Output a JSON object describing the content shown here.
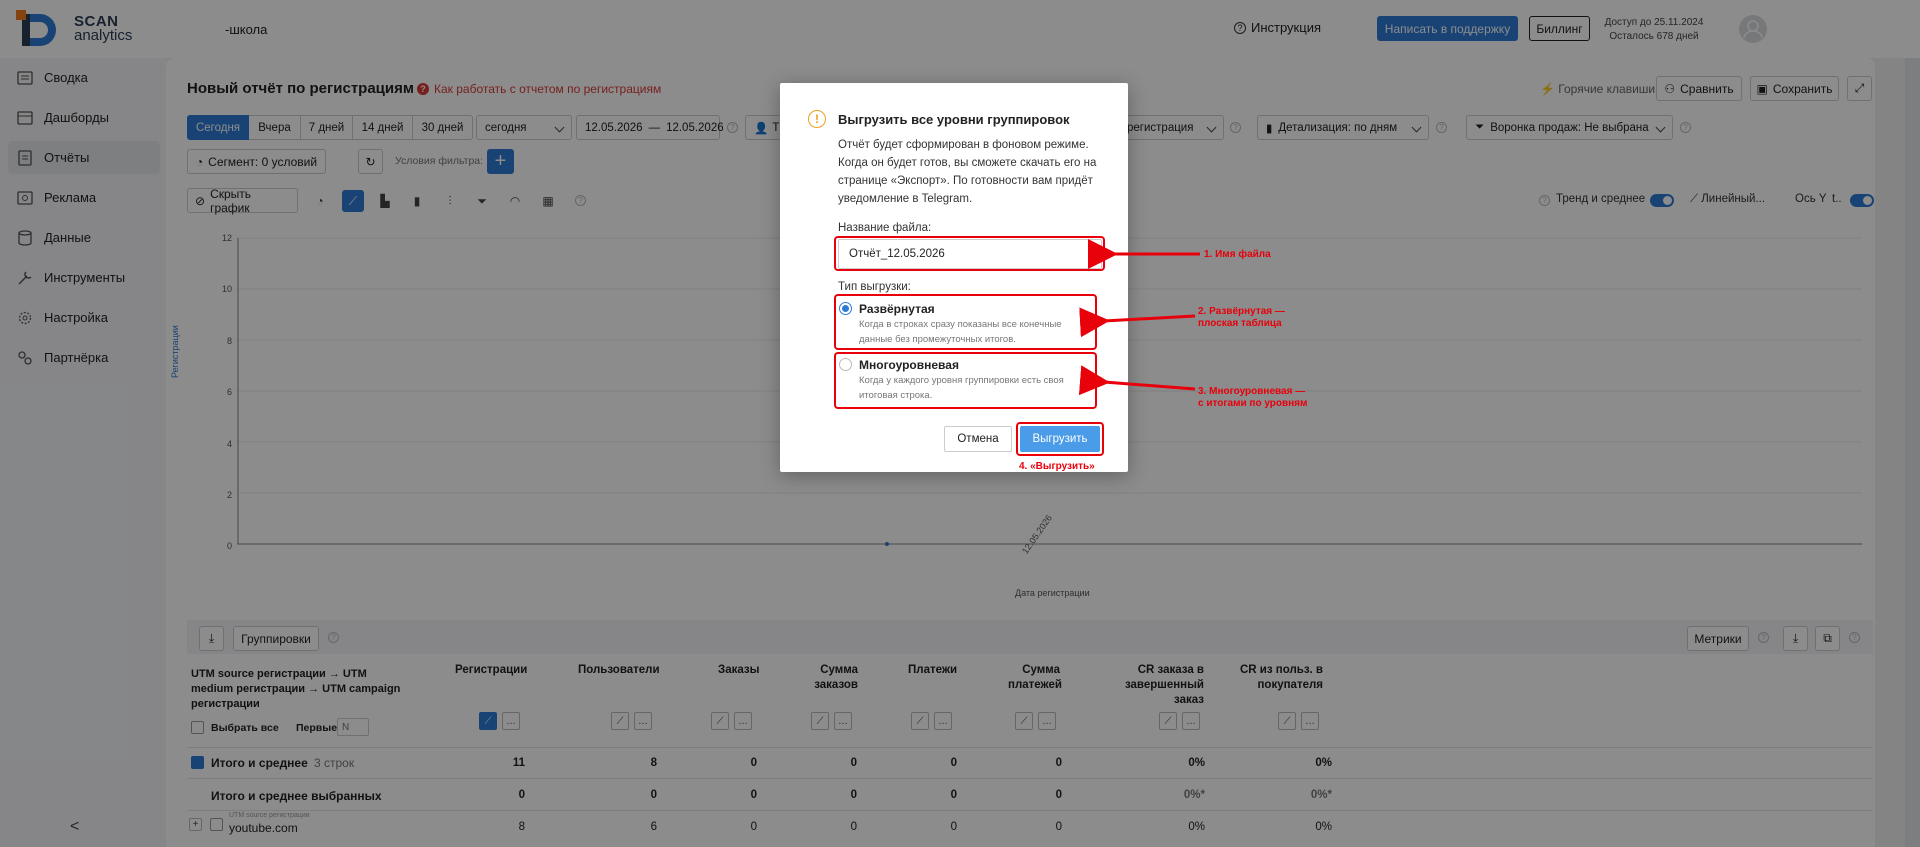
{
  "logo": {
    "line1": "SCAN",
    "line2": "analytics"
  },
  "header": {
    "school": "-школа",
    "help_link": "Инструкция",
    "support_button": "Написать в поддержку",
    "billing_button": "Биллинг",
    "access_line1": "Доступ до 25.11.2024",
    "access_line2": "Осталось 678 дней"
  },
  "sidebar": {
    "items": [
      {
        "label": "Сводка",
        "icon": "summary-icon"
      },
      {
        "label": "Дашборды",
        "icon": "dashboard-icon"
      },
      {
        "label": "Отчёты",
        "icon": "reports-icon",
        "active": true
      },
      {
        "label": "Реклама",
        "icon": "ads-icon"
      },
      {
        "label": "Данные",
        "icon": "database-icon"
      },
      {
        "label": "Инструменты",
        "icon": "tools-icon"
      },
      {
        "label": "Настройка",
        "icon": "settings-icon"
      },
      {
        "label": "Партнёрка",
        "icon": "partner-icon"
      }
    ],
    "collapse": "<"
  },
  "report": {
    "title": "Новый отчёт по регистрациям",
    "howto_link": "Как работать с отчетом по регистрациям",
    "hotkeys": "Горячие клавиши",
    "compare": "Сравнить",
    "save": "Сохранить"
  },
  "period": {
    "tabs": [
      "Сегодня",
      "Вчера",
      "7 дней",
      "14 дней",
      "30 дней"
    ],
    "select": "сегодня",
    "date_from": "12.05.2026",
    "date_sep": "—",
    "date_to": "12.05.2026",
    "attr_value": "Т",
    "grouping_dd": "регистрация",
    "detail_dd": "Детализация: по дням",
    "funnel_dd": "Воронка продаж: Не выбрана"
  },
  "filters": {
    "segment": "Сегмент: 0 условий",
    "conditions_label": "Условия фильтра:"
  },
  "chart_toolbar": {
    "hide_chart": "Скрыть график",
    "trend_label": "Тренд и среднее",
    "linear_label": "Линейный...",
    "axis_label": "Ось Y",
    "axis_suffix": "t.."
  },
  "chart_data": {
    "type": "line",
    "title": "",
    "xlabel": "Дата регистрации",
    "ylabel": "Регистрации",
    "ylim": [
      0,
      12
    ],
    "yticks": [
      "12",
      "10",
      "8",
      "6",
      "4",
      "2",
      "0"
    ],
    "categories": [
      "12.05.2026"
    ],
    "series": [
      {
        "values": [
          0
        ]
      }
    ],
    "grid": true
  },
  "table_toolbar": {
    "groupings": "Группировки",
    "metrics": "Метрики"
  },
  "table": {
    "group_header": "UTM source регистрации → UTM medium регистрации → UTM campaign регистрации",
    "select_all": "Выбрать все",
    "first_label": "Первые",
    "first_placeholder": "N",
    "columns": [
      "Регистрации",
      "Пользователи",
      "Заказы",
      "Сумма заказов",
      "Платежи",
      "Сумма платежей",
      "CR заказа в завершенный заказ",
      "CR из польз. в покупателя"
    ],
    "total_row": {
      "label": "Итого и среднее",
      "count": "3 строк",
      "values": [
        "11",
        "8",
        "0",
        "0",
        "0",
        "0",
        "0%",
        "0%"
      ]
    },
    "selected_row": {
      "label": "Итого и среднее выбранных",
      "values": [
        "0",
        "0",
        "0",
        "0",
        "0",
        "0",
        "0%*",
        "0%*"
      ]
    },
    "data_row": {
      "hint": "UTM source регистрации",
      "label": "youtube.com",
      "values": [
        "8",
        "6",
        "0",
        "0",
        "0",
        "0",
        "0%",
        "0%"
      ]
    }
  },
  "modal": {
    "title": "Выгрузить все уровни группировок",
    "description": "Отчёт будет сформирован в фоновом режиме. Когда он будет готов, вы сможете скачать его на странице «Экспорт». По готовности вам придёт уведомление в Telegram.",
    "filename_label": "Название файла:",
    "filename_value": "Отчёт_12.05.2026",
    "type_label": "Тип выгрузки:",
    "option1_title": "Развёрнутая",
    "option1_desc": "Когда в строках сразу показаны все конечные данные без промежуточных итогов.",
    "option2_title": "Многоуровневая",
    "option2_desc": "Когда у каждого уровня группировки есть своя итоговая строка.",
    "cancel": "Отмена",
    "export": "Выгрузить"
  },
  "annotations": {
    "a1": "1. Имя файла",
    "a2_line1": "2. Развёрнутая —",
    "a2_line2": "плоская таблица",
    "a3_line1": "3. Многоуровневая —",
    "a3_line2": "с итогами по уровням",
    "a4": "4. «Выгрузить»",
    "color": "#e8000b"
  }
}
